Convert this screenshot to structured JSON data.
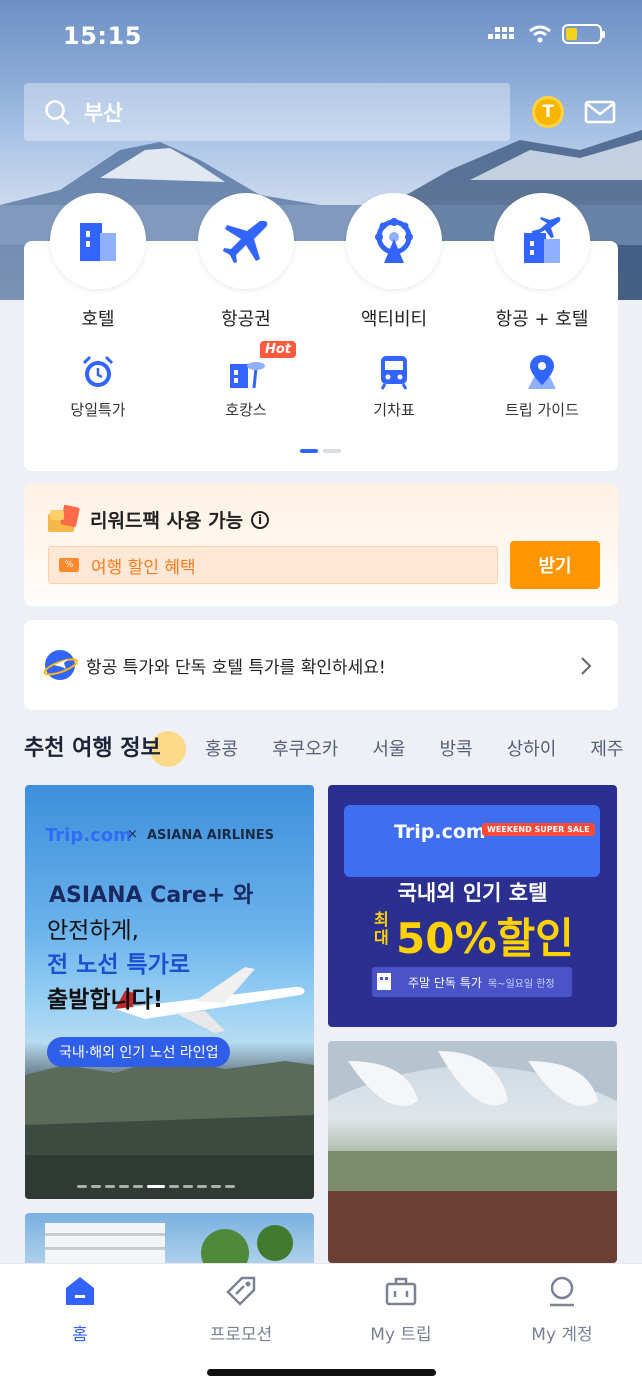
{
  "status_bar": {
    "time": "15:15",
    "battery_level": 0.35
  },
  "search": {
    "query": "부산"
  },
  "header": {
    "coin_label": "T"
  },
  "services": {
    "primary": [
      {
        "label": "호텔",
        "icon": "hotel-icon"
      },
      {
        "label": "항공권",
        "icon": "airplane-icon"
      },
      {
        "label": "액티비티",
        "icon": "ferris-wheel-icon"
      },
      {
        "label": "항공 + 호텔",
        "icon": "flight-hotel-icon"
      }
    ],
    "secondary": [
      {
        "label": "당일특가",
        "icon": "alarm-clock-icon"
      },
      {
        "label": "호캉스",
        "icon": "resort-icon",
        "badge": "Hot"
      },
      {
        "label": "기차표",
        "icon": "train-icon"
      },
      {
        "label": "트립 가이드",
        "icon": "map-pin-icon"
      }
    ],
    "page_indicator": {
      "current": 1,
      "total": 2
    }
  },
  "rewards": {
    "title": "리워드팩 사용 가능",
    "field_text": "여행 할인 혜택",
    "button": "받기"
  },
  "promo_banner": {
    "text": "항공 특가와 단독 호텔 특가를 확인하세요!"
  },
  "recommended": {
    "title": "추천 여행 정보",
    "tabs": [
      "홍콩",
      "후쿠오카",
      "서울",
      "방콕",
      "상하이",
      "제주"
    ]
  },
  "cards": {
    "asiana": {
      "brand": "Trip.com",
      "x": "×",
      "airline": "ASIANA AIRLINES",
      "line1": "ASIANA Care+ 와",
      "line2": "안전하게,",
      "line3": "전 노선 특가로",
      "line4": "출발합니다!",
      "pill": "국내·해외 인기 노선 라인업"
    },
    "hotel_sale": {
      "brand": "Trip.com",
      "badge": "WEEKEND SUPER SALE",
      "headline": "국내외 인기 호텔",
      "max": "최대",
      "discount": "50%할인",
      "sub": "주말 단독 특가",
      "sub_small": "목~일요일 한정"
    }
  },
  "tab_bar": {
    "items": [
      {
        "label": "홈",
        "icon": "home-icon",
        "active": true
      },
      {
        "label": "프로모션",
        "icon": "tag-icon",
        "active": false
      },
      {
        "label": "My 트립",
        "icon": "briefcase-icon",
        "active": false
      },
      {
        "label": "My 계정",
        "icon": "user-icon",
        "active": false
      }
    ]
  },
  "colors": {
    "accent": "#3264ff",
    "reward_button": "#ff9500",
    "hot_badge": "#ff5a3c"
  }
}
